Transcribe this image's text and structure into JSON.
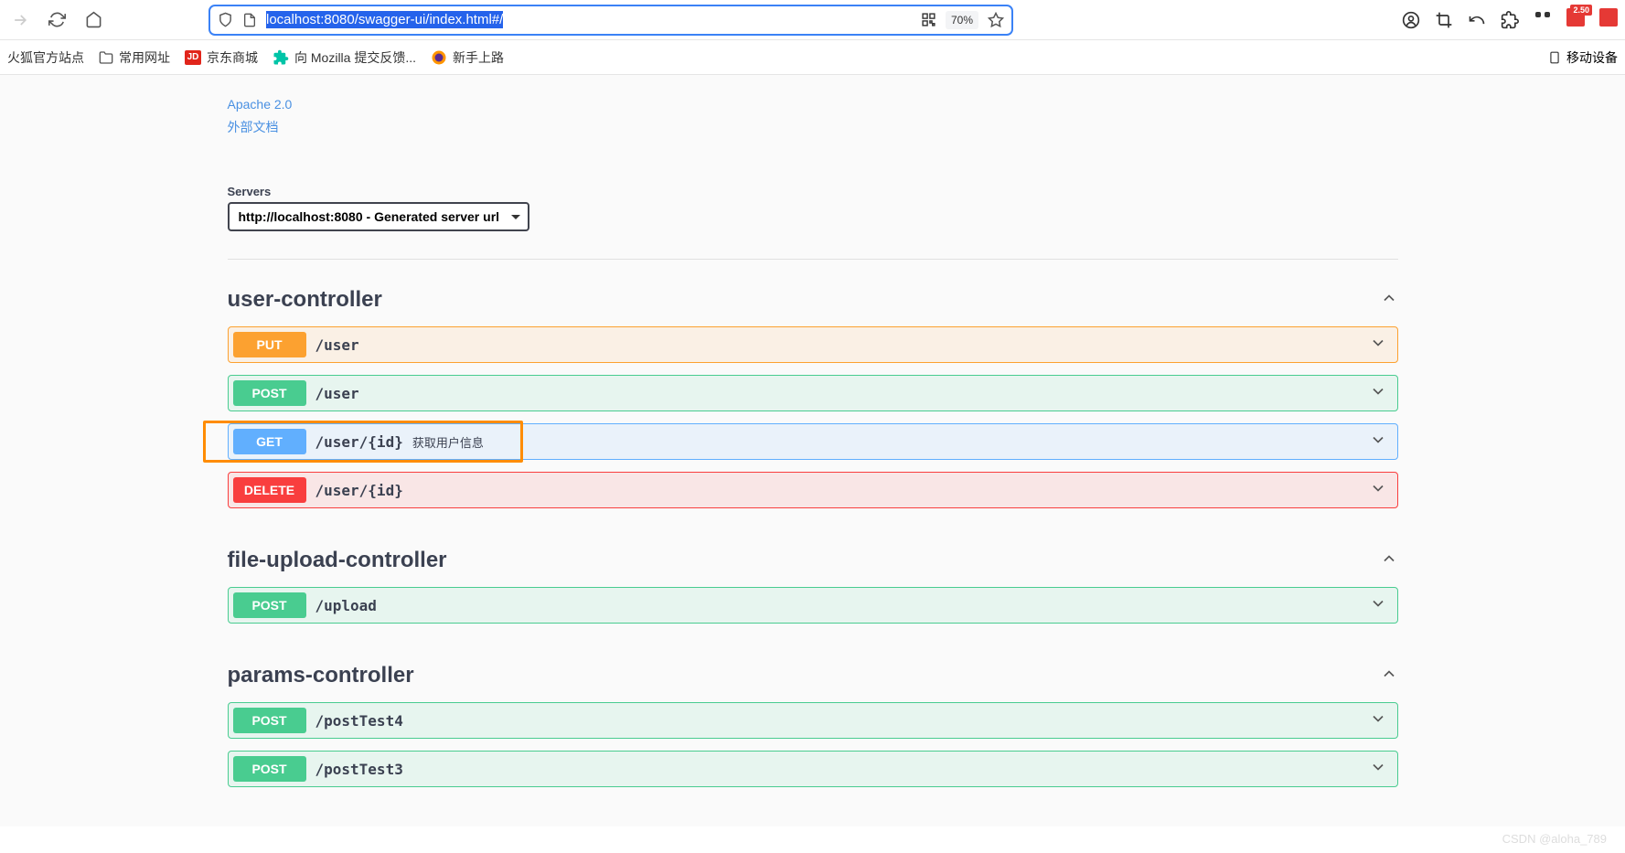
{
  "browser": {
    "url": "localhost:8080/swagger-ui/index.html#/",
    "zoom": "70%"
  },
  "bookmarks": {
    "official": "火狐官方站点",
    "common": "常用网址",
    "jd": "京东商城",
    "mozilla": "向 Mozilla 提交反馈...",
    "newbie": "新手上路",
    "mobile": "移动设备"
  },
  "info": {
    "license": "Apache 2.0",
    "external_docs": "外部文档"
  },
  "servers": {
    "label": "Servers",
    "selected": "http://localhost:8080 - Generated server url"
  },
  "tags": [
    {
      "name": "user-controller",
      "operations": [
        {
          "method": "PUT",
          "path": "/user",
          "summary": "",
          "style": "put"
        },
        {
          "method": "POST",
          "path": "/user",
          "summary": "",
          "style": "post"
        },
        {
          "method": "GET",
          "path": "/user/{id}",
          "summary": "获取用户信息",
          "style": "get",
          "highlighted": true
        },
        {
          "method": "DELETE",
          "path": "/user/{id}",
          "summary": "",
          "style": "delete"
        }
      ]
    },
    {
      "name": "file-upload-controller",
      "operations": [
        {
          "method": "POST",
          "path": "/upload",
          "summary": "",
          "style": "post"
        }
      ]
    },
    {
      "name": "params-controller",
      "operations": [
        {
          "method": "POST",
          "path": "/postTest4",
          "summary": "",
          "style": "post"
        },
        {
          "method": "POST",
          "path": "/postTest3",
          "summary": "",
          "style": "post"
        }
      ]
    }
  ],
  "watermark": "CSDN @aloha_789",
  "ext_badge": "2.50"
}
